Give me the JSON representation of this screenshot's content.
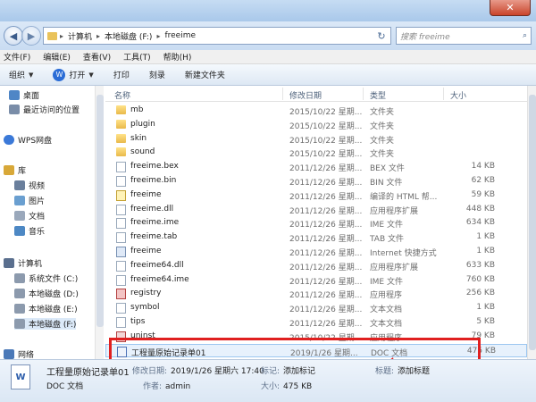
{
  "window": {
    "close_glyph": "✕"
  },
  "address_bar": {
    "segments": [
      "计算机",
      "本地磁盘 (F:)",
      "freeime"
    ],
    "search_placeholder": "搜索 freeime"
  },
  "menu": [
    "文件(F)",
    "编辑(E)",
    "查看(V)",
    "工具(T)",
    "帮助(H)"
  ],
  "toolbar": {
    "organize": "组织",
    "open": "打开",
    "print": "打印",
    "burn": "刻录",
    "new_folder": "新建文件夹"
  },
  "nav_pane": {
    "items": [
      {
        "label": "桌面",
        "icon": "desktop-icon",
        "color": "#4f86c6"
      },
      {
        "label": "最近访问的位置",
        "icon": "recent-places-icon",
        "color": "#7a8da8"
      },
      {
        "label": "WPS网盘",
        "icon": "cloud-icon",
        "color": "#3b79d8"
      },
      {
        "label": "库",
        "icon": "library-icon",
        "color": "#d8a838"
      },
      {
        "label": "视频",
        "icon": "video-icon",
        "color": "#6a7f9c"
      },
      {
        "label": "图片",
        "icon": "picture-icon",
        "color": "#6a9fd0"
      },
      {
        "label": "文档",
        "icon": "document-icon",
        "color": "#9aa8bb"
      },
      {
        "label": "音乐",
        "icon": "music-icon",
        "color": "#4d88c4"
      },
      {
        "label": "计算机",
        "icon": "computer-icon",
        "color": "#5a6f8e"
      },
      {
        "label": "系统文件 (C:)",
        "icon": "drive-icon",
        "color": "#8c9aad"
      },
      {
        "label": "本地磁盘 (D:)",
        "icon": "drive-icon",
        "color": "#8c9aad"
      },
      {
        "label": "本地磁盘 (E:)",
        "icon": "drive-icon",
        "color": "#8c9aad"
      },
      {
        "label": "本地磁盘 (F:)",
        "icon": "drive-icon",
        "color": "#8c9aad"
      },
      {
        "label": "网络",
        "icon": "network-icon",
        "color": "#4b79b8"
      }
    ]
  },
  "columns": {
    "name": "名称",
    "date": "修改日期",
    "type": "类型",
    "size": "大小"
  },
  "files": [
    {
      "name": "mb",
      "date": "2015/10/22 星期...",
      "type": "文件夹",
      "size": "",
      "icon": "folder"
    },
    {
      "name": "plugin",
      "date": "2015/10/22 星期...",
      "type": "文件夹",
      "size": "",
      "icon": "folder"
    },
    {
      "name": "skin",
      "date": "2015/10/22 星期...",
      "type": "文件夹",
      "size": "",
      "icon": "folder"
    },
    {
      "name": "sound",
      "date": "2015/10/22 星期...",
      "type": "文件夹",
      "size": "",
      "icon": "folder"
    },
    {
      "name": "freeime.bex",
      "date": "2011/12/26 星期...",
      "type": "BEX 文件",
      "size": "14 KB",
      "icon": "doc"
    },
    {
      "name": "freeime.bin",
      "date": "2011/12/26 星期...",
      "type": "BIN 文件",
      "size": "62 KB",
      "icon": "doc"
    },
    {
      "name": "freeime",
      "date": "2011/12/26 星期...",
      "type": "编译的 HTML 帮...",
      "size": "59 KB",
      "icon": "htm"
    },
    {
      "name": "freeime.dll",
      "date": "2011/12/26 星期...",
      "type": "应用程序扩展",
      "size": "448 KB",
      "icon": "doc"
    },
    {
      "name": "freeime.ime",
      "date": "2011/12/26 星期...",
      "type": "IME 文件",
      "size": "634 KB",
      "icon": "doc"
    },
    {
      "name": "freeime.tab",
      "date": "2011/12/26 星期...",
      "type": "TAB 文件",
      "size": "1 KB",
      "icon": "doc"
    },
    {
      "name": "freeime",
      "date": "2011/12/26 星期...",
      "type": "Internet 快捷方式",
      "size": "1 KB",
      "icon": "exe"
    },
    {
      "name": "freeime64.dll",
      "date": "2011/12/26 星期...",
      "type": "应用程序扩展",
      "size": "633 KB",
      "icon": "doc"
    },
    {
      "name": "freeime64.ime",
      "date": "2011/12/26 星期...",
      "type": "IME 文件",
      "size": "760 KB",
      "icon": "doc"
    },
    {
      "name": "registry",
      "date": "2011/12/26 星期...",
      "type": "应用程序",
      "size": "256 KB",
      "icon": "reg"
    },
    {
      "name": "symbol",
      "date": "2011/12/26 星期...",
      "type": "文本文档",
      "size": "1 KB",
      "icon": "doc"
    },
    {
      "name": "tips",
      "date": "2011/12/26 星期...",
      "type": "文本文档",
      "size": "5 KB",
      "icon": "doc"
    },
    {
      "name": "uninst",
      "date": "2015/10/22 星期...",
      "type": "应用程序",
      "size": "79 KB",
      "icon": "exe2"
    },
    {
      "name": "工程量原始记录单01",
      "date": "2019/1/26 星期...",
      "type": "DOC 文档",
      "size": "475 KB",
      "icon": "wdoc",
      "selected": true
    }
  ],
  "details": {
    "filename": "工程量原始记录单01",
    "filetype": "DOC 文档",
    "modified_label": "修改日期:",
    "modified_value": "2019/1/26 星期六 17:40",
    "tags_label": "标记:",
    "tags_value": "添加标记",
    "title_label": "标题:",
    "title_value": "添加标题",
    "author_label": "作者:",
    "author_value": "admin",
    "size_label": "大小:",
    "size_value": "475 KB",
    "icon_letter": "W"
  }
}
